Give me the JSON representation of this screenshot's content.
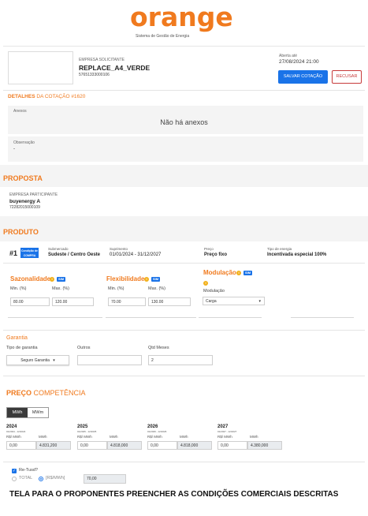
{
  "logo": {
    "word": "orange",
    "tagline": "Sistema de Gestão de Energia"
  },
  "header": {
    "company_label": "EMPRESA SOLICITANTE",
    "company_name": "REPLACE_A4_VERDE",
    "company_cnpj": "57651333000106",
    "open_until_label": "Aberta até",
    "open_until_value": "27/08/2024 21:00",
    "save_button": "SALVAR COTAÇÃO",
    "reject_button": "RECUSAR"
  },
  "details": {
    "title_a": "DETALHES",
    "title_b": "DA COTAÇÃO #1620",
    "attachments_label": "Anexos",
    "no_attachments": "Não há anexos",
    "observation_label": "Observação",
    "observation_value": "-"
  },
  "proposal": {
    "title": "PROPOSTA",
    "participant_label": "EMPRESA PARTICIPANTE",
    "participant_name": "buyenergy A",
    "participant_cnpj": "72282015000109"
  },
  "product": {
    "title": "PRODUTO",
    "number": "#1",
    "condition_badge": "Condição de COMPRA",
    "submarket_label": "Submercado",
    "submarket_value": "Sudeste / Centro Oeste",
    "supply_label": "Suprimento",
    "supply_value": "01/01/2024 - 31/12/2027",
    "price_label": "Preço",
    "price_value": "Preço fixo",
    "energy_label": "Tipo de energia",
    "energy_value": "Incentivada especial 100%",
    "seasonality": {
      "title": "Sazonalidade",
      "badge": "SIM",
      "min_label": "Min. (%)",
      "max_label": "Max. (%)",
      "min_value": "80.00",
      "max_value": "120.00"
    },
    "flexibility": {
      "title": "Flexibilidade",
      "badge": "SIM",
      "min_label": "Min. (%)",
      "max_label": "Max. (%)",
      "min_value": "70.00",
      "max_value": "130.00"
    },
    "modulation": {
      "title": "Modulação",
      "badge": "SIM",
      "field_label": "Modulação",
      "selected": "Carga"
    }
  },
  "guarantee": {
    "title": "Garantia",
    "type_label": "Tipo de garantia",
    "type_selected": "Seguro Garantia",
    "others_label": "Outros",
    "months_label": "Qtd Meses",
    "months_value": "2"
  },
  "price": {
    "title_a": "PREÇO",
    "title_b": "COMPETÊNCIA",
    "unit_toggle": [
      "MWh",
      "MWm"
    ],
    "years": [
      {
        "year": "2024",
        "period": "01/2024 - 12/2024",
        "col1": "R$/ MWh",
        "col2": "MWh",
        "price": "0,00",
        "volume": "4.831,200"
      },
      {
        "year": "2025",
        "period": "01/2025 - 12/2025",
        "col1": "R$/ MWh",
        "col2": "MWh",
        "price": "0,00",
        "volume": "4.818,000"
      },
      {
        "year": "2026",
        "period": "01/2026 - 12/2026",
        "col1": "R$/ MWh",
        "col2": "MWh",
        "price": "0,00",
        "volume": "4.818,000"
      },
      {
        "year": "2027",
        "period": "01/2027 - 12/2027",
        "col1": "R$/ MWh",
        "col2": "MWh",
        "price": "0,00",
        "volume": "4.380,000"
      }
    ],
    "retusd_label": "Re-Tusd?",
    "total_label": "TOTAL",
    "rmwh_label": "[R$/MWh]",
    "retusd_value": "70,00"
  },
  "caption": "TELA PARA O PROPONENTES PREENCHER AS CONDIÇÕES COMERCIAIS DESCRITAS",
  "colors": {
    "brand": "#f07a1e",
    "primary": "#1a73e8",
    "danger": "#c73a3a"
  }
}
